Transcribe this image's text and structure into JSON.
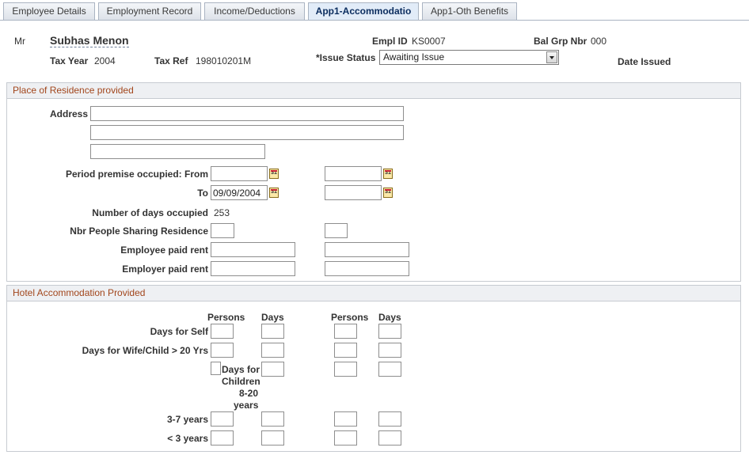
{
  "tabs": [
    {
      "label": "Employee Details",
      "active": false
    },
    {
      "label": "Employment Record",
      "active": false
    },
    {
      "label": "Income/Deductions",
      "active": false
    },
    {
      "label": "App1-Accommodatio",
      "active": true
    },
    {
      "label": "App1-Oth Benefits",
      "active": false
    }
  ],
  "header": {
    "salutation": "Mr",
    "name": "Subhas Menon",
    "empl_id_label": "Empl ID",
    "empl_id": "KS0007",
    "bal_grp_label": "Bal Grp Nbr",
    "bal_grp": "000",
    "tax_year_label": "Tax Year",
    "tax_year": "2004",
    "tax_ref_label": "Tax Ref",
    "tax_ref": "198010201M",
    "issue_status_label": "*Issue Status",
    "issue_status": "Awaiting Issue",
    "date_issued_label": "Date Issued"
  },
  "residence": {
    "title": "Place of Residence provided",
    "address_label": "Address",
    "period_from_label": "Period premise occupied: From",
    "to_label": "To",
    "to_date": "09/09/2004",
    "days_occupied_label": "Number of days occupied",
    "days_occupied": "253",
    "people_sharing_label": "Nbr People Sharing Residence",
    "employee_rent_label": "Employee paid rent",
    "employer_rent_label": "Employer paid rent"
  },
  "hotel": {
    "title": "Hotel Accommodation Provided",
    "persons_label": "Persons",
    "days_label": "Days",
    "persons_label2": "Persons",
    "days_label2": "Days",
    "self_label": "Days for Self",
    "wife_label": "Days for Wife/Child > 20 Yrs",
    "children_label_1": "Days for",
    "children_label_2": "Children",
    "children_label_3": "8-20",
    "children_label_4": "years",
    "age37_label": "3-7 years",
    "under3_label": "< 3 years"
  },
  "icons": {
    "calendar": "calendar-icon"
  },
  "colors": {
    "section_title": "#a2461c",
    "active_tab": "#e2ecf8"
  }
}
